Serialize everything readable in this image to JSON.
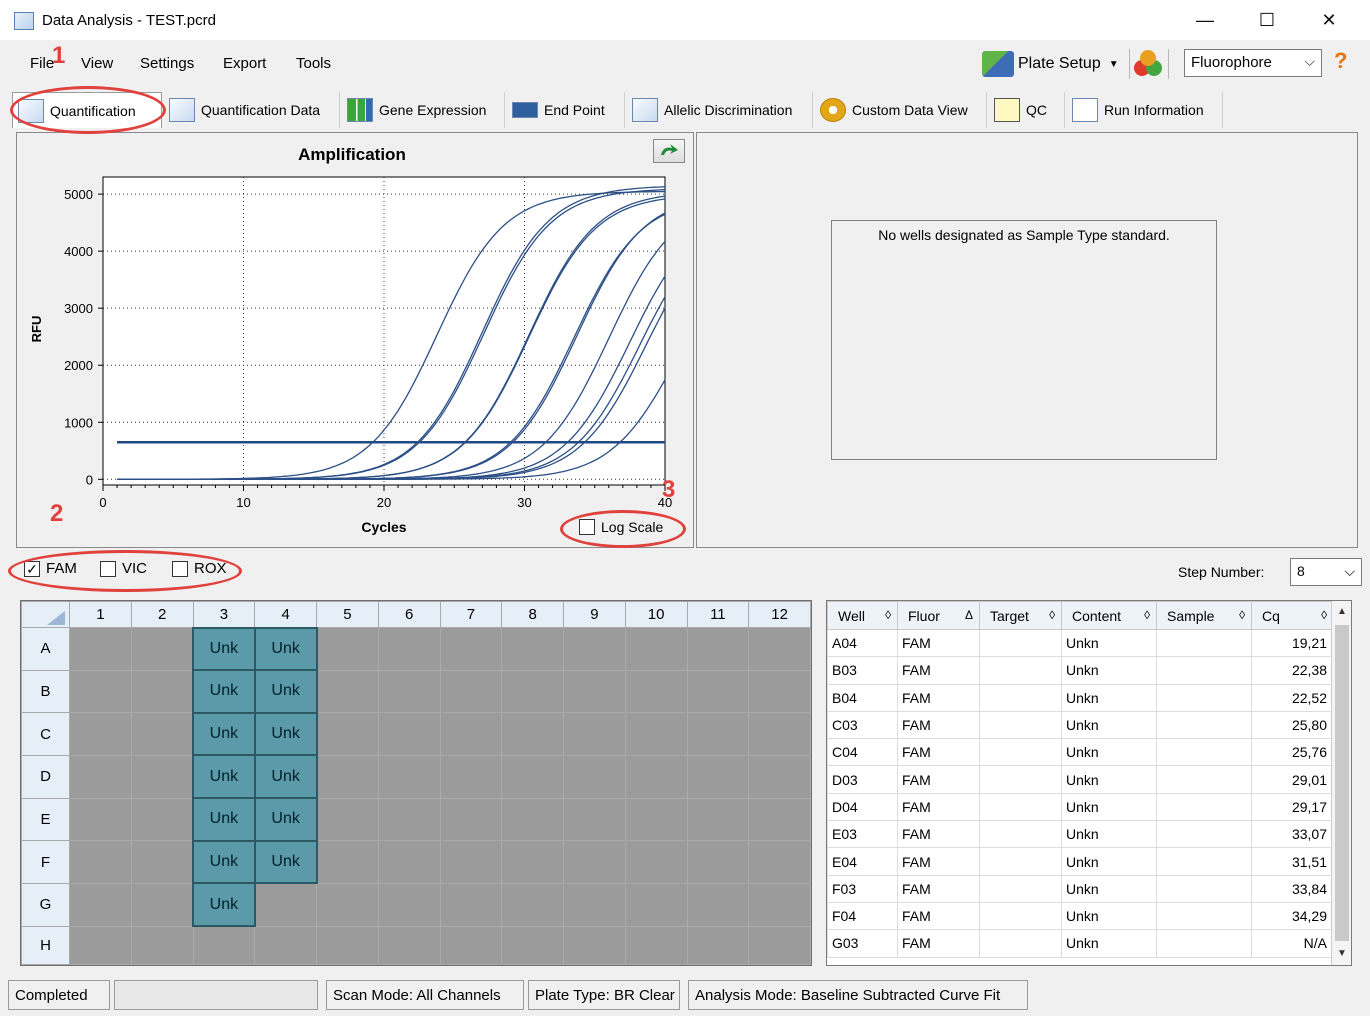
{
  "window": {
    "title": "Data Analysis - TEST.pcrd",
    "minimize": "—",
    "maximize": "☐",
    "close": "✕"
  },
  "menu": {
    "items": [
      "File",
      "View",
      "Settings",
      "Export",
      "Tools"
    ],
    "plate_setup": "Plate Setup",
    "fluorophore": "Fluorophore",
    "help": "?"
  },
  "tabs": [
    "Quantification",
    "Quantification Data",
    "Gene Expression",
    "End Point",
    "Allelic Discrimination",
    "Custom Data View",
    "QC",
    "Run Information"
  ],
  "chart_data": {
    "type": "line",
    "title": "Amplification",
    "xlabel": "Cycles",
    "ylabel": "RFU",
    "xlim": [
      0,
      40
    ],
    "ylim": [
      -100,
      5300
    ],
    "x_ticks": [
      0,
      10,
      20,
      30,
      40
    ],
    "y_ticks": [
      0,
      1000,
      2000,
      3000,
      4000,
      5000
    ],
    "grid": true,
    "threshold": 650,
    "series": [
      {
        "cq": 19.21,
        "plateau": 5050
      },
      {
        "cq": 22.38,
        "plateau": 5150
      },
      {
        "cq": 22.52,
        "plateau": 5100
      },
      {
        "cq": 25.8,
        "plateau": 5000
      },
      {
        "cq": 25.76,
        "plateau": 5050
      },
      {
        "cq": 29.01,
        "plateau": 4950
      },
      {
        "cq": 29.17,
        "plateau": 5000
      },
      {
        "cq": 33.07,
        "plateau": 4800
      },
      {
        "cq": 31.51,
        "plateau": 4950
      },
      {
        "cq": 33.84,
        "plateau": 4700
      },
      {
        "cq": 34.29,
        "plateau": 4700
      },
      {
        "cq": 36.8,
        "plateau": 4300
      }
    ]
  },
  "standard_panel": {
    "message": "No wells designated as Sample Type standard."
  },
  "log_scale": {
    "label": "Log Scale",
    "checked": false
  },
  "fluors": [
    {
      "label": "FAM",
      "checked": true
    },
    {
      "label": "VIC",
      "checked": false
    },
    {
      "label": "ROX",
      "checked": false
    }
  ],
  "step": {
    "label": "Step Number:",
    "value": "8"
  },
  "plate": {
    "columns": [
      "1",
      "2",
      "3",
      "4",
      "5",
      "6",
      "7",
      "8",
      "9",
      "10",
      "11",
      "12"
    ],
    "rows": [
      "A",
      "B",
      "C",
      "D",
      "E",
      "F",
      "G",
      "H"
    ],
    "cells": [
      [
        "",
        "",
        "Unk",
        "Unk",
        "",
        "",
        "",
        "",
        "",
        "",
        "",
        ""
      ],
      [
        "",
        "",
        "Unk",
        "Unk",
        "",
        "",
        "",
        "",
        "",
        "",
        "",
        ""
      ],
      [
        "",
        "",
        "Unk",
        "Unk",
        "",
        "",
        "",
        "",
        "",
        "",
        "",
        ""
      ],
      [
        "",
        "",
        "Unk",
        "Unk",
        "",
        "",
        "",
        "",
        "",
        "",
        "",
        ""
      ],
      [
        "",
        "",
        "Unk",
        "Unk",
        "",
        "",
        "",
        "",
        "",
        "",
        "",
        ""
      ],
      [
        "",
        "",
        "Unk",
        "Unk",
        "",
        "",
        "",
        "",
        "",
        "",
        "",
        ""
      ],
      [
        "",
        "",
        "Unk",
        "",
        "",
        "",
        "",
        "",
        "",
        "",
        "",
        ""
      ],
      [
        "",
        "",
        "",
        "",
        "",
        "",
        "",
        "",
        "",
        "",
        "",
        ""
      ]
    ]
  },
  "results": {
    "headers": [
      "Well",
      "Fluor",
      "Target",
      "Content",
      "Sample",
      "Cq"
    ],
    "sort_glyphs": [
      "◊",
      "Δ",
      "◊",
      "◊",
      "◊",
      "◊"
    ],
    "rows": [
      [
        "A04",
        "FAM",
        "",
        "Unkn",
        "",
        "19,21"
      ],
      [
        "B03",
        "FAM",
        "",
        "Unkn",
        "",
        "22,38"
      ],
      [
        "B04",
        "FAM",
        "",
        "Unkn",
        "",
        "22,52"
      ],
      [
        "C03",
        "FAM",
        "",
        "Unkn",
        "",
        "25,80"
      ],
      [
        "C04",
        "FAM",
        "",
        "Unkn",
        "",
        "25,76"
      ],
      [
        "D03",
        "FAM",
        "",
        "Unkn",
        "",
        "29,01"
      ],
      [
        "D04",
        "FAM",
        "",
        "Unkn",
        "",
        "29,17"
      ],
      [
        "E03",
        "FAM",
        "",
        "Unkn",
        "",
        "33,07"
      ],
      [
        "E04",
        "FAM",
        "",
        "Unkn",
        "",
        "31,51"
      ],
      [
        "F03",
        "FAM",
        "",
        "Unkn",
        "",
        "33,84"
      ],
      [
        "F04",
        "FAM",
        "",
        "Unkn",
        "",
        "34,29"
      ],
      [
        "G03",
        "FAM",
        "",
        "Unkn",
        "",
        "N/A"
      ]
    ]
  },
  "status": [
    "Completed",
    "",
    "Scan Mode: All Channels",
    "Plate Type: BR Clear",
    "Analysis Mode: Baseline Subtracted Curve Fit"
  ],
  "annotations": [
    "1",
    "2",
    "3"
  ],
  "colors": {
    "curve": "#2b4f86",
    "annotation": "#e0413c",
    "well": "#5b9aa8"
  }
}
